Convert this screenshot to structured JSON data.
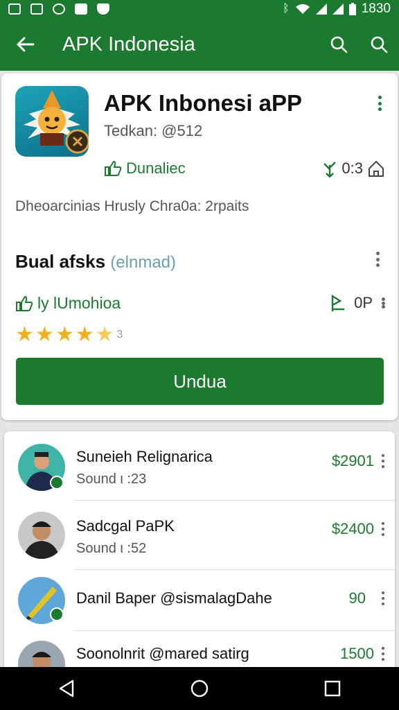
{
  "status_bar": {
    "time": "1830",
    "left_icons": [
      "gallery-icon",
      "image-icon",
      "chrome-icon",
      "save-icon",
      "shield-icon"
    ]
  },
  "app_bar": {
    "title": "APK Indonesia"
  },
  "app_card": {
    "name": "APK Inbonesi aPP",
    "subtitle": "Tedkan: @512",
    "developer": "Dunaliec",
    "meta_value": "0:3",
    "description": "Dheoarcinias Hrusly Chra0a: 2rpaits",
    "section_title": "Bual afsks",
    "section_hint": "(elnmad)",
    "rating_label": "ly lUmohioa",
    "rating_value": "0P",
    "stars": 4.5,
    "stars_count": "3",
    "download_label": "Undua"
  },
  "list": [
    {
      "name": "Suneieh Relignarica",
      "sub": "Sound ι :23",
      "price": "$2901"
    },
    {
      "name": "Sadcgal PaPK",
      "sub": "Sound ι :52",
      "price": "$2400"
    },
    {
      "name": "Danil Baper @sismalagDahe",
      "sub": "",
      "price": "90"
    },
    {
      "name": "Soonolnrit @mared satirg",
      "sub": "",
      "price": "1500"
    }
  ],
  "colors": {
    "primary": "#1b7a2f",
    "star": "#f2b01e",
    "background": "#e6e6e6"
  }
}
